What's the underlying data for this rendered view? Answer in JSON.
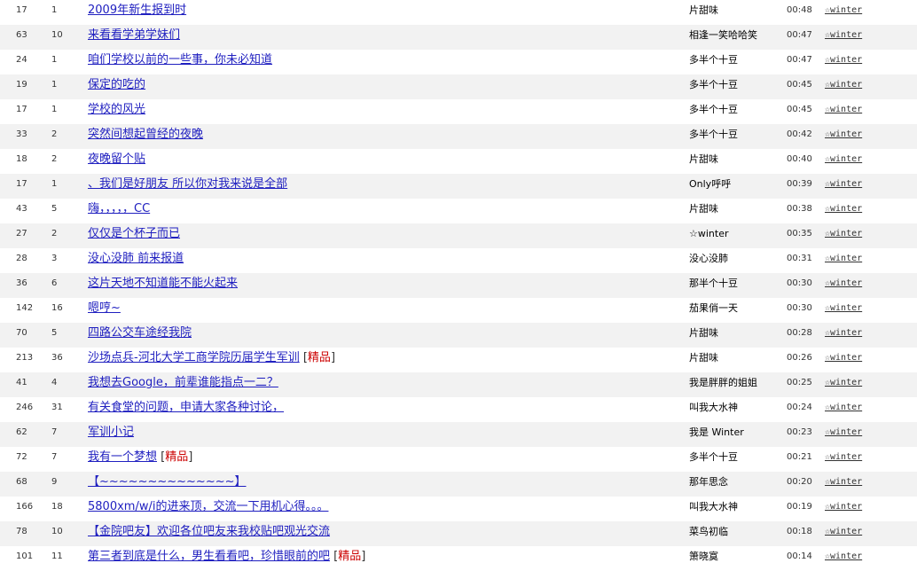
{
  "threads": [
    {
      "replies": "17",
      "clicks": "1",
      "title": "2009年新生报到时",
      "badge": "",
      "author": "片甜味",
      "time": "00:48",
      "last_reply": "☆winter"
    },
    {
      "replies": "63",
      "clicks": "10",
      "title": "来看看学弟学妹们",
      "badge": "",
      "author": "相逢一笑哈哈笑",
      "time": "00:47",
      "last_reply": "☆winter"
    },
    {
      "replies": "24",
      "clicks": "1",
      "title": "咱们学校以前的一些事，你未必知道",
      "badge": "",
      "author": "多半个十豆",
      "time": "00:47",
      "last_reply": "☆winter"
    },
    {
      "replies": "19",
      "clicks": "1",
      "title": "保定的吃的",
      "badge": "",
      "author": "多半个十豆",
      "time": "00:45",
      "last_reply": "☆winter"
    },
    {
      "replies": "17",
      "clicks": "1",
      "title": "学校的风光",
      "badge": "",
      "author": "多半个十豆",
      "time": "00:45",
      "last_reply": "☆winter"
    },
    {
      "replies": "33",
      "clicks": "2",
      "title": "突然间想起曾经的夜晚",
      "badge": "",
      "author": "多半个十豆",
      "time": "00:42",
      "last_reply": "☆winter"
    },
    {
      "replies": "18",
      "clicks": "2",
      "title": "夜晚留个贴",
      "badge": "",
      "author": "片甜味",
      "time": "00:40",
      "last_reply": "☆winter"
    },
    {
      "replies": "17",
      "clicks": "1",
      "title": "、我们是好朋友 所以你对我来说是全部",
      "badge": "",
      "author": "Only呼呼",
      "time": "00:39",
      "last_reply": "☆winter"
    },
    {
      "replies": "43",
      "clicks": "5",
      "title": "嗨，，，，，CC",
      "badge": "",
      "author": "片甜味",
      "time": "00:38",
      "last_reply": "☆winter"
    },
    {
      "replies": "27",
      "clicks": "2",
      "title": "仅仅是个杯子而已",
      "badge": "",
      "author": "☆winter",
      "time": "00:35",
      "last_reply": "☆winter"
    },
    {
      "replies": "28",
      "clicks": "3",
      "title": "没心没肺 前来报道",
      "badge": "",
      "author": "没心没肺",
      "time": "00:31",
      "last_reply": "☆winter"
    },
    {
      "replies": "36",
      "clicks": "6",
      "title": "这片天地不知道能不能火起来",
      "badge": "",
      "author": "那半个十豆",
      "time": "00:30",
      "last_reply": "☆winter"
    },
    {
      "replies": "142",
      "clicks": "16",
      "title": "嗯哼~",
      "badge": "",
      "author": "茄果俏一天",
      "time": "00:30",
      "last_reply": "☆winter"
    },
    {
      "replies": "70",
      "clicks": "5",
      "title": "四路公交车途经我院",
      "badge": "",
      "author": "片甜味",
      "time": "00:28",
      "last_reply": "☆winter"
    },
    {
      "replies": "213",
      "clicks": "36",
      "title": "沙场点兵-河北大学工商学院历届学生军训",
      "badge": "精品",
      "author": "片甜味",
      "time": "00:26",
      "last_reply": "☆winter"
    },
    {
      "replies": "41",
      "clicks": "4",
      "title": "我想去Google，前辈谁能指点一二？",
      "badge": "",
      "author": "我是胖胖的姐姐",
      "time": "00:25",
      "last_reply": "☆winter"
    },
    {
      "replies": "246",
      "clicks": "31",
      "title": "有关食堂的问题，申请大家各种讨论，",
      "badge": "",
      "author": "叫我大水神",
      "time": "00:24",
      "last_reply": "☆winter"
    },
    {
      "replies": "62",
      "clicks": "7",
      "title": "军训小记",
      "badge": "",
      "author": "我是 Winter",
      "time": "00:23",
      "last_reply": "☆winter"
    },
    {
      "replies": "72",
      "clicks": "7",
      "title": "我有一个梦想",
      "badge": "精品",
      "author": "多半个十豆",
      "time": "00:21",
      "last_reply": "☆winter"
    },
    {
      "replies": "68",
      "clicks": "9",
      "title": "【~~~~~~~~~~~~~~】",
      "badge": "",
      "author": "那年思念",
      "time": "00:20",
      "last_reply": "☆winter"
    },
    {
      "replies": "166",
      "clicks": "18",
      "title": "5800xm/w/i的进来顶，交流一下用机心得。。。",
      "badge": "",
      "author": "叫我大水神",
      "time": "00:19",
      "last_reply": "☆winter"
    },
    {
      "replies": "78",
      "clicks": "10",
      "title": "【金院吧友】欢迎各位吧友来我校贴吧观光交流",
      "badge": "",
      "author": "菜鸟初临",
      "time": "00:18",
      "last_reply": "☆winter"
    },
    {
      "replies": "101",
      "clicks": "11",
      "title": "第三者到底是什么，男生看看吧，珍惜眼前的吧",
      "badge": "精品",
      "author": "箫晓寞",
      "time": "00:14",
      "last_reply": "☆winter"
    }
  ],
  "colors": {
    "link": "#2020c0",
    "badge": "#cc0000",
    "alt_row": "#f2f2f2"
  }
}
